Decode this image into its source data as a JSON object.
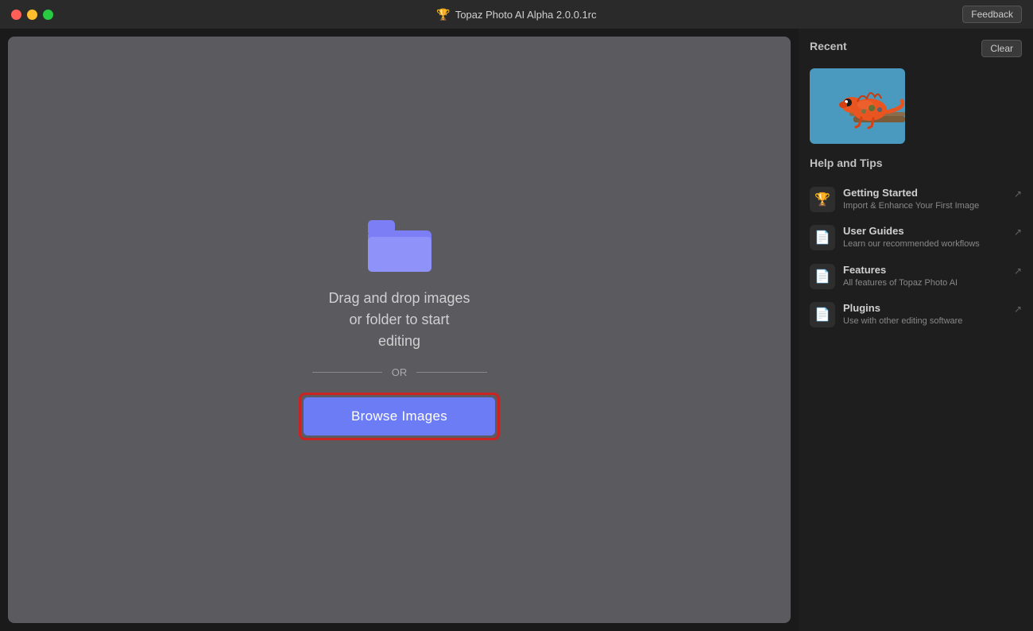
{
  "titlebar": {
    "title": "Topaz Photo AI Alpha 2.0.0.1rc",
    "feedback_label": "Feedback"
  },
  "drop_zone": {
    "drag_text": "Drag and drop images\nor folder to start\nediting",
    "or_text": "OR",
    "browse_label": "Browse Images"
  },
  "sidebar": {
    "recent_label": "Recent",
    "clear_label": "Clear",
    "help_title": "Help and Tips",
    "help_items": [
      {
        "id": "getting-started",
        "icon": "trophy",
        "title": "Getting Started",
        "subtitle": "Import & Enhance Your First Image"
      },
      {
        "id": "user-guides",
        "icon": "doc",
        "title": "User Guides",
        "subtitle": "Learn our recommended workflows"
      },
      {
        "id": "features",
        "icon": "doc",
        "title": "Features",
        "subtitle": "All features of Topaz Photo AI"
      },
      {
        "id": "plugins",
        "icon": "doc",
        "title": "Plugins",
        "subtitle": "Use with other editing software"
      }
    ]
  }
}
